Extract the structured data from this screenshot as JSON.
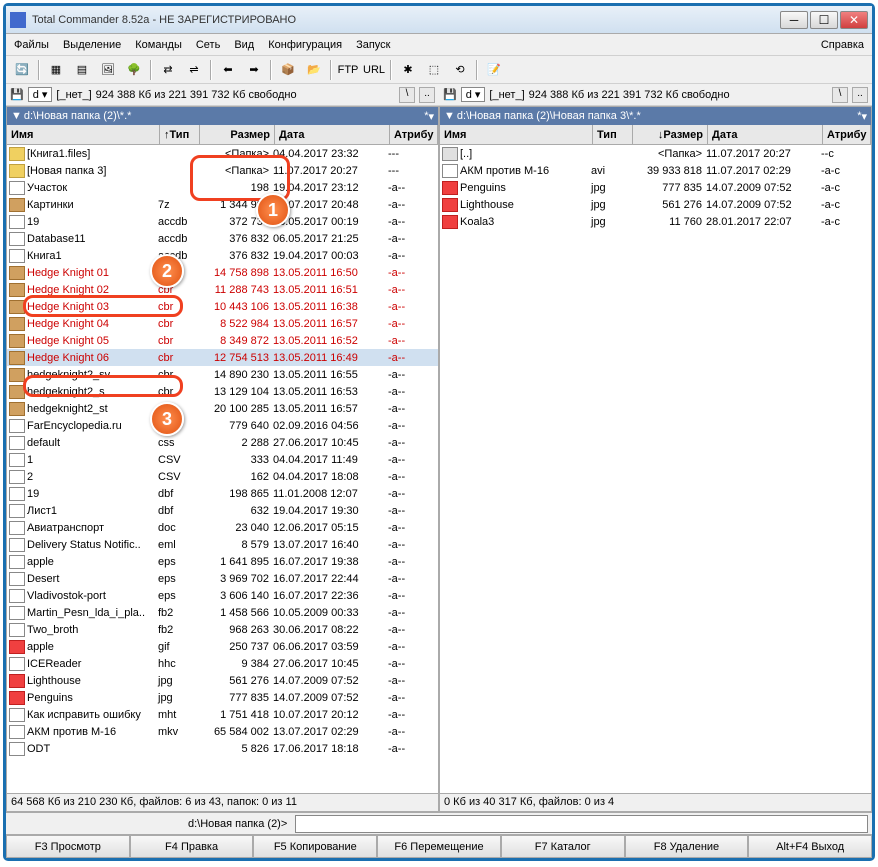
{
  "title": "Total Commander 8.52a - НЕ ЗАРЕГИСТРИРОВАНО",
  "menu": {
    "files": "Файлы",
    "select": "Выделение",
    "commands": "Команды",
    "net": "Сеть",
    "view": "Вид",
    "config": "Конфигурация",
    "run": "Запуск",
    "help": "Справка"
  },
  "drive": {
    "letter": "d",
    "none": "[_нет_]",
    "info": "924 388 Кб из 221 391 732 Кб свободно"
  },
  "left": {
    "path": "d:\\Новая папка (2)\\*.* ",
    "cols": {
      "name": "Имя",
      "ext": "Тип",
      "size": "Размер",
      "date": "Дата",
      "attr": "Атрибу"
    },
    "sortArrow": "↑",
    "status": "64 568 Кб из 210 230 Кб, файлов: 6 из 43, папок: 0 из 11",
    "rows": [
      {
        "ic": "folder",
        "name": "[Книга1.files]",
        "ext": "",
        "size": "<Папка>",
        "date": "04.04.2017 23:32",
        "attr": "---"
      },
      {
        "ic": "folder",
        "name": "[Новая папка 3]",
        "ext": "",
        "size": "<Папка>",
        "date": "11.07.2017 20:27",
        "attr": "---"
      },
      {
        "ic": "file",
        "name": "Участок",
        "ext": "",
        "size": "198",
        "date": "19.04.2017 23:12",
        "attr": "-a--"
      },
      {
        "ic": "arc",
        "name": "Картинки",
        "ext": "7z",
        "size": "1 344 993",
        "date": "03.07.2017 20:48",
        "attr": "-a--"
      },
      {
        "ic": "file",
        "name": "19",
        "ext": "accdb",
        "size": "372 736",
        "date": "08.05.2017 00:19",
        "attr": "-a--"
      },
      {
        "ic": "file",
        "name": "Database11",
        "ext": "accdb",
        "size": "376 832",
        "date": "06.05.2017 21:25",
        "attr": "-a--"
      },
      {
        "ic": "file",
        "name": "Книга1",
        "ext": "accdb",
        "size": "376 832",
        "date": "19.04.2017 00:03",
        "attr": "-a--"
      },
      {
        "ic": "arc",
        "name": "Hedge Knight 01",
        "ext": "cbr",
        "size": "14 758 898",
        "date": "13.05.2011 16:50",
        "attr": "-a--",
        "red": true
      },
      {
        "ic": "arc",
        "name": "Hedge Knight 02",
        "ext": "cbr",
        "size": "11 288 743",
        "date": "13.05.2011 16:51",
        "attr": "-a--",
        "red": true
      },
      {
        "ic": "arc",
        "name": "Hedge Knight 03",
        "ext": "cbr",
        "size": "10 443 106",
        "date": "13.05.2011 16:38",
        "attr": "-a--",
        "red": true
      },
      {
        "ic": "arc",
        "name": "Hedge Knight 04",
        "ext": "cbr",
        "size": "8 522 984",
        "date": "13.05.2011 16:57",
        "attr": "-a--",
        "red": true
      },
      {
        "ic": "arc",
        "name": "Hedge Knight 05",
        "ext": "cbr",
        "size": "8 349 872",
        "date": "13.05.2011 16:52",
        "attr": "-a--",
        "red": true
      },
      {
        "ic": "arc",
        "name": "Hedge Knight 06",
        "ext": "cbr",
        "size": "12 754 513",
        "date": "13.05.2011 16:49",
        "attr": "-a--",
        "red": true,
        "sel": true
      },
      {
        "ic": "arc",
        "name": "hedgeknight2_sv",
        "ext": "cbr",
        "size": "14 890 230",
        "date": "13.05.2011 16:55",
        "attr": "-a--"
      },
      {
        "ic": "arc",
        "name": "hedgeknight2_s",
        "ext": "cbr",
        "size": "13 129 104",
        "date": "13.05.2011 16:53",
        "attr": "-a--"
      },
      {
        "ic": "arc",
        "name": "hedgeknight2_st",
        "ext": "cbr",
        "size": "20 100 285",
        "date": "13.05.2011 16:57",
        "attr": "-a--"
      },
      {
        "ic": "file",
        "name": "FarEncyclopedia.ru",
        "ext": "chm",
        "size": "779 640",
        "date": "02.09.2016 04:56",
        "attr": "-a--"
      },
      {
        "ic": "file",
        "name": "default",
        "ext": "css",
        "size": "2 288",
        "date": "27.06.2017 10:45",
        "attr": "-a--"
      },
      {
        "ic": "file",
        "name": "1",
        "ext": "CSV",
        "size": "333",
        "date": "04.04.2017 11:49",
        "attr": "-a--"
      },
      {
        "ic": "file",
        "name": "2",
        "ext": "CSV",
        "size": "162",
        "date": "04.04.2017 18:08",
        "attr": "-a--"
      },
      {
        "ic": "file",
        "name": "19",
        "ext": "dbf",
        "size": "198 865",
        "date": "11.01.2008 12:07",
        "attr": "-a--"
      },
      {
        "ic": "file",
        "name": "Лист1",
        "ext": "dbf",
        "size": "632",
        "date": "19.04.2017 19:30",
        "attr": "-a--"
      },
      {
        "ic": "file",
        "name": "Авиатранспорт",
        "ext": "doc",
        "size": "23 040",
        "date": "12.06.2017 05:15",
        "attr": "-a--"
      },
      {
        "ic": "file",
        "name": "Delivery Status Notific..",
        "ext": "eml",
        "size": "8 579",
        "date": "13.07.2017 16:40",
        "attr": "-a--"
      },
      {
        "ic": "file",
        "name": "apple",
        "ext": "eps",
        "size": "1 641 895",
        "date": "16.07.2017 19:38",
        "attr": "-a--"
      },
      {
        "ic": "file",
        "name": "Desert",
        "ext": "eps",
        "size": "3 969 702",
        "date": "16.07.2017 22:44",
        "attr": "-a--"
      },
      {
        "ic": "file",
        "name": "Vladivostok-port",
        "ext": "eps",
        "size": "3 606 140",
        "date": "16.07.2017 22:36",
        "attr": "-a--"
      },
      {
        "ic": "file",
        "name": "Martin_Pesn_lda_i_pla..",
        "ext": "fb2",
        "size": "1 458 566",
        "date": "10.05.2009 00:33",
        "attr": "-a--"
      },
      {
        "ic": "file",
        "name": "Two_broth",
        "ext": "fb2",
        "size": "968 263",
        "date": "30.06.2017 08:22",
        "attr": "-a--"
      },
      {
        "ic": "img",
        "name": "apple",
        "ext": "gif",
        "size": "250 737",
        "date": "06.06.2017 03:59",
        "attr": "-a--"
      },
      {
        "ic": "file",
        "name": "ICEReader",
        "ext": "hhc",
        "size": "9 384",
        "date": "27.06.2017 10:45",
        "attr": "-a--"
      },
      {
        "ic": "img",
        "name": "Lighthouse",
        "ext": "jpg",
        "size": "561 276",
        "date": "14.07.2009 07:52",
        "attr": "-a--"
      },
      {
        "ic": "img",
        "name": "Penguins",
        "ext": "jpg",
        "size": "777 835",
        "date": "14.07.2009 07:52",
        "attr": "-a--"
      },
      {
        "ic": "file",
        "name": "Как исправить ошибку",
        "ext": "mht",
        "size": "1 751 418",
        "date": "10.07.2017 20:12",
        "attr": "-a--"
      },
      {
        "ic": "file",
        "name": "АКМ против М-16",
        "ext": "mkv",
        "size": "65 584 002",
        "date": "13.07.2017 02:29",
        "attr": "-a--"
      },
      {
        "ic": "file",
        "name": "ODT",
        "ext": "",
        "size": "5 826",
        "date": "17.06.2017 18:18",
        "attr": "-a--"
      }
    ]
  },
  "right": {
    "path": "d:\\Новая папка (2)\\Новая папка 3\\*.* ",
    "cols": {
      "name": "Имя",
      "ext": "Тип",
      "size": "Размер",
      "date": "Дата",
      "attr": "Атрибу"
    },
    "sortArrow": "↓",
    "status": "0 Кб из 40 317 Кб, файлов: 0 из 4",
    "rows": [
      {
        "ic": "up",
        "name": "[..]",
        "ext": "",
        "size": "<Папка>",
        "date": "11.07.2017 20:27",
        "attr": "--c"
      },
      {
        "ic": "file",
        "name": "АКМ против М-16",
        "ext": "avi",
        "size": "39 933 818",
        "date": "11.07.2017 02:29",
        "attr": "-a-c"
      },
      {
        "ic": "img",
        "name": "Penguins",
        "ext": "jpg",
        "size": "777 835",
        "date": "14.07.2009 07:52",
        "attr": "-a-c"
      },
      {
        "ic": "img",
        "name": "Lighthouse",
        "ext": "jpg",
        "size": "561 276",
        "date": "14.07.2009 07:52",
        "attr": "-a-c"
      },
      {
        "ic": "img",
        "name": "Koala3",
        "ext": "jpg",
        "size": "11 760",
        "date": "28.01.2017 22:07",
        "attr": "-a-c"
      }
    ]
  },
  "cmdline": "d:\\Новая папка (2)>",
  "fkeys": {
    "f3": "F3 Просмотр",
    "f4": "F4 Правка",
    "f5": "F5 Копирование",
    "f6": "F6 Перемещение",
    "f7": "F7 Каталог",
    "f8": "F8 Удаление",
    "altf4": "Alt+F4 Выход"
  }
}
